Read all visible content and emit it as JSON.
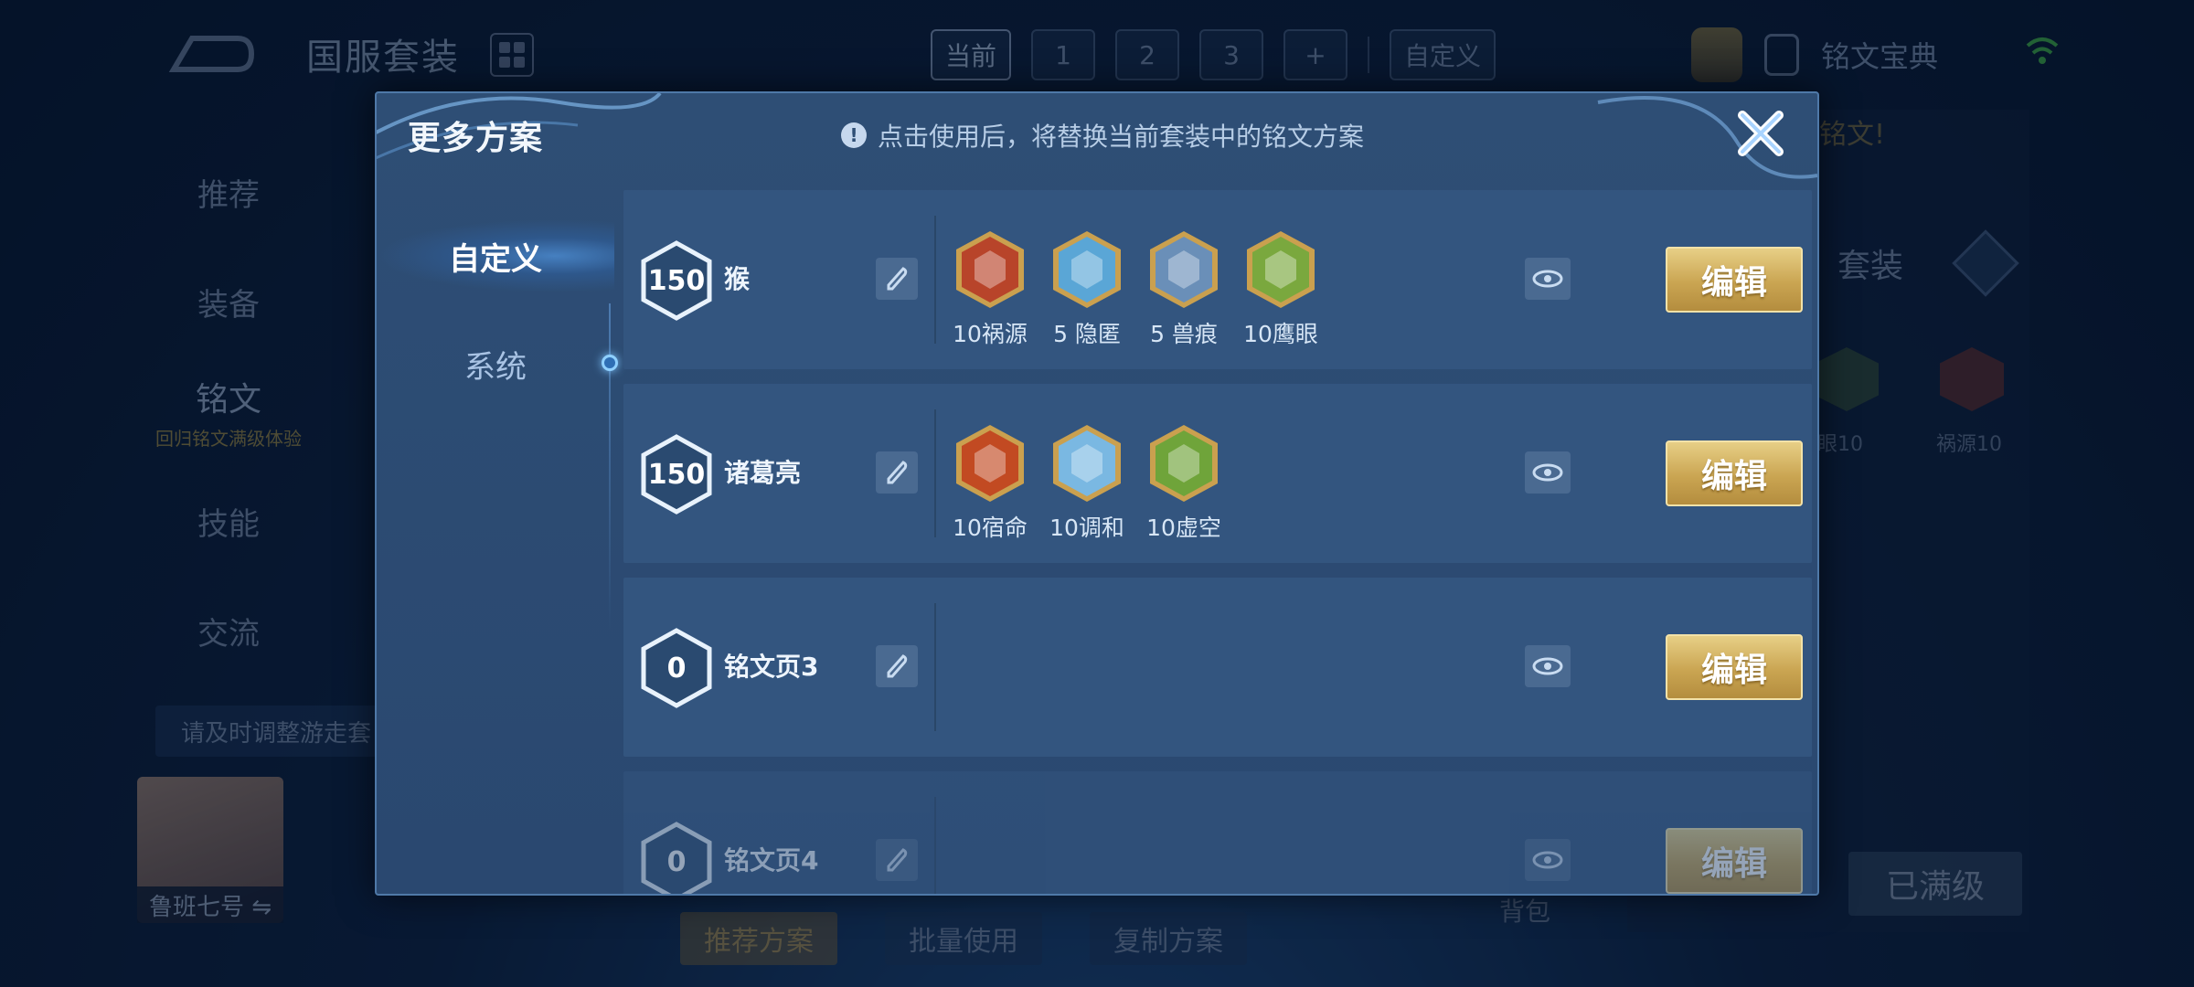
{
  "background": {
    "title": "国服套装",
    "tabs": [
      "当前",
      "1",
      "2",
      "3",
      "+"
    ],
    "custom_tab": "自定义",
    "rune_book": "铭文宝典",
    "side_nav": [
      {
        "label": "推荐"
      },
      {
        "label": "装备"
      },
      {
        "label": "铭文",
        "sub": "回归铭文满级体验"
      },
      {
        "label": "技能"
      },
      {
        "label": "交流"
      }
    ],
    "tip": "请及时调整游走套",
    "hero_name": "鲁班七号 ⇋",
    "bottom_buttons": [
      "推荐方案",
      "批量使用",
      "复制方案"
    ],
    "bag_label": "背包",
    "maxed_button": "已满级",
    "right_panel": {
      "badge": "铭文!",
      "suit": "套装",
      "rune_label_1": "眼10",
      "rune_label_2": "祸源10"
    }
  },
  "modal": {
    "title": "更多方案",
    "hint": "点击使用后，将替换当前套装中的铭文方案",
    "side_tabs": [
      "自定义",
      "系统"
    ],
    "edit_label": "编辑",
    "pages": [
      {
        "level": "150",
        "name": "猴",
        "runes": [
          {
            "label": "10祸源",
            "icon": "rune-red-icon",
            "color": "#b8442a"
          },
          {
            "label": "5 隐匿",
            "icon": "rune-blue-icon",
            "color": "#5aa6d6"
          },
          {
            "label": "5 兽痕",
            "icon": "rune-silver-blue-icon",
            "color": "#6a8fb8"
          },
          {
            "label": "10鹰眼",
            "icon": "rune-green-icon",
            "color": "#7aa83e"
          }
        ]
      },
      {
        "level": "150",
        "name": "诸葛亮",
        "runes": [
          {
            "label": "10宿命",
            "icon": "rune-red-icon",
            "color": "#c24a22"
          },
          {
            "label": "10调和",
            "icon": "rune-blue-icon",
            "color": "#7ab8e2"
          },
          {
            "label": "10虚空",
            "icon": "rune-green-icon",
            "color": "#6fa43a"
          }
        ]
      },
      {
        "level": "0",
        "name": "铭文页3",
        "runes": []
      },
      {
        "level": "0",
        "name": "铭文页4",
        "runes": []
      }
    ]
  }
}
